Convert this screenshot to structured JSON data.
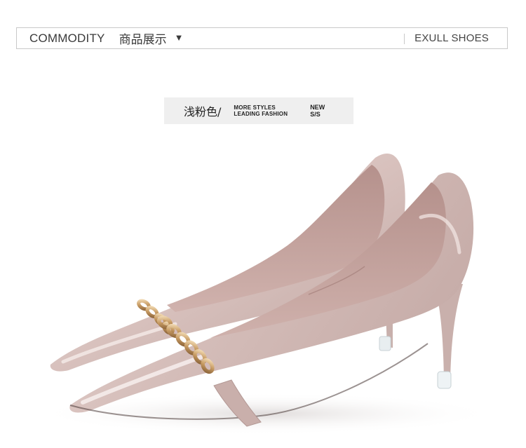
{
  "header": {
    "title_en": "COMMODITY",
    "title_cn": "商品展示",
    "caret_icon": "▼",
    "brand": "EXULL SHOES"
  },
  "color_tag": {
    "color_name": "浅粉色/",
    "slogan_line1": "MORE STYLES",
    "slogan_line2": "LEADING FASHION",
    "season_line1": "NEW",
    "season_line2": "S/S"
  },
  "product": {
    "icon": "pointed-toe-pump-shoes-image",
    "primary_color": "#dcc6c2",
    "shadow_color": "#b89f9b",
    "lining_color": "#c9aaa5",
    "chain_color": "#c9a06a"
  }
}
